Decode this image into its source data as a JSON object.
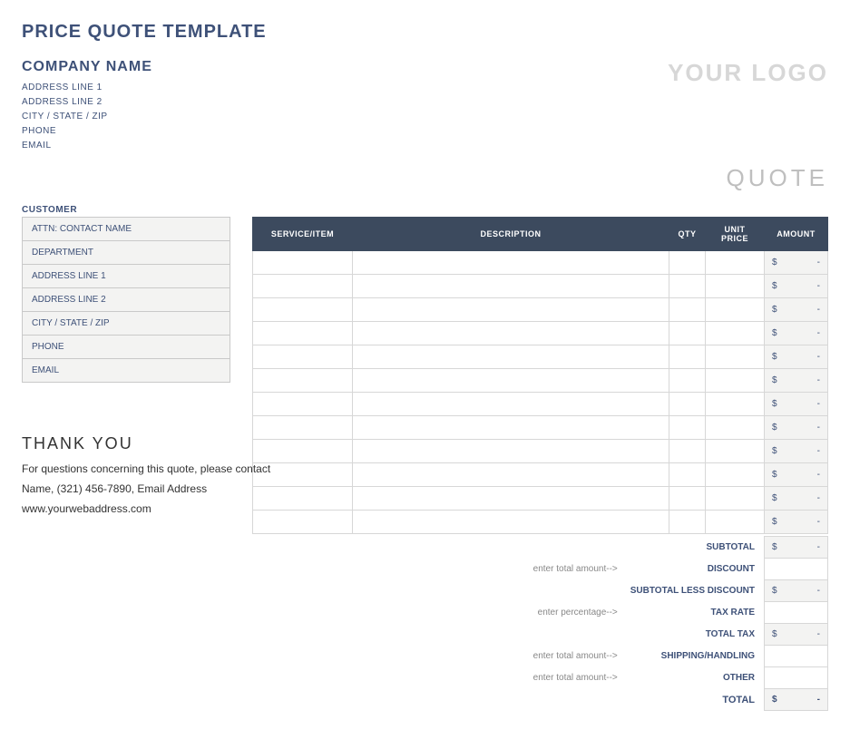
{
  "title": "PRICE QUOTE TEMPLATE",
  "logo_text": "YOUR LOGO",
  "quote_label": "QUOTE",
  "company": {
    "name": "COMPANY NAME",
    "address1": "ADDRESS LINE 1",
    "address2": "ADDRESS LINE 2",
    "city_state_zip": "CITY / STATE / ZIP",
    "phone": "PHONE",
    "email": "EMAIL"
  },
  "customer_heading": "CUSTOMER",
  "customer_fields": {
    "contact": "ATTN: CONTACT NAME",
    "department": "DEPARTMENT",
    "address1": "ADDRESS LINE 1",
    "address2": "ADDRESS LINE 2",
    "city_state_zip": "CITY / STATE / ZIP",
    "phone": "PHONE",
    "email": "EMAIL"
  },
  "items_header": {
    "service": "SERVICE/ITEM",
    "description": "DESCRIPTION",
    "qty": "QTY",
    "unit_price": "UNIT PRICE",
    "amount": "AMOUNT"
  },
  "currency": "$",
  "dash": "-",
  "row_count": 12,
  "totals": {
    "subtotal_label": "SUBTOTAL",
    "discount_hint": "enter total amount-->",
    "discount_label": "DISCOUNT",
    "subtotal_less_label": "SUBTOTAL LESS DISCOUNT",
    "taxrate_hint": "enter percentage-->",
    "taxrate_label": "TAX RATE",
    "totaltax_label": "TOTAL TAX",
    "shipping_hint": "enter total amount-->",
    "shipping_label": "SHIPPING/HANDLING",
    "other_hint": "enter total amount-->",
    "other_label": "OTHER",
    "grand_label": "TOTAL"
  },
  "thank": {
    "title": "THANK YOU",
    "line1": "For questions concerning this quote, please contact",
    "line2": "Name, (321) 456-7890, Email Address",
    "line3": "www.yourwebaddress.com"
  }
}
